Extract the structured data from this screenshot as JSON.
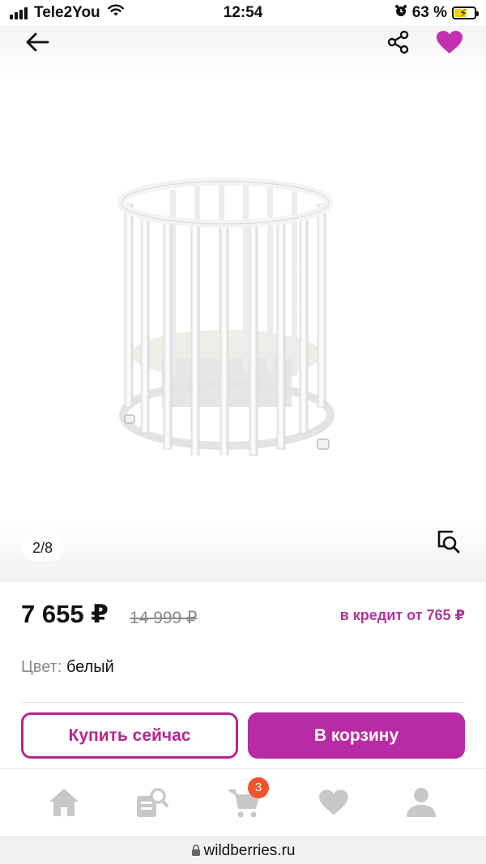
{
  "status_bar": {
    "carrier": "Tele2You",
    "time": "12:54",
    "battery_percent": "63 %",
    "battery_level": 0.63,
    "icons": [
      "signal-icon",
      "wifi-icon",
      "alarm-icon",
      "battery-charging-icon"
    ]
  },
  "header": {
    "icons": [
      "back-arrow-icon",
      "share-icon",
      "heart-icon"
    ],
    "favorite_color": "#c22fb0"
  },
  "gallery": {
    "counter": "2/8",
    "current_image": 2,
    "total_images": 8,
    "icons": [
      "visual-search-icon"
    ]
  },
  "product": {
    "price": "7 655 ₽",
    "old_price": "14 999 ₽",
    "credit": "в кредит от 765 ₽",
    "color_label": "Цвет:",
    "color_value": "белый"
  },
  "actions": {
    "buy_now_label": "Купить сейчас",
    "add_to_cart_label": "В корзину",
    "accent_color": "#b82ba5"
  },
  "bottom_nav": {
    "items": [
      {
        "name": "home",
        "icon": "home-icon"
      },
      {
        "name": "catalog-search",
        "icon": "catalog-search-icon"
      },
      {
        "name": "cart",
        "icon": "cart-icon",
        "badge": "3"
      },
      {
        "name": "favorites",
        "icon": "heart-icon"
      },
      {
        "name": "profile",
        "icon": "profile-icon"
      }
    ],
    "icon_color": "#c8c8c8",
    "badge_color": "#f2522b"
  },
  "url_bar": {
    "url": "wildberries.ru",
    "icon": "lock-icon"
  }
}
